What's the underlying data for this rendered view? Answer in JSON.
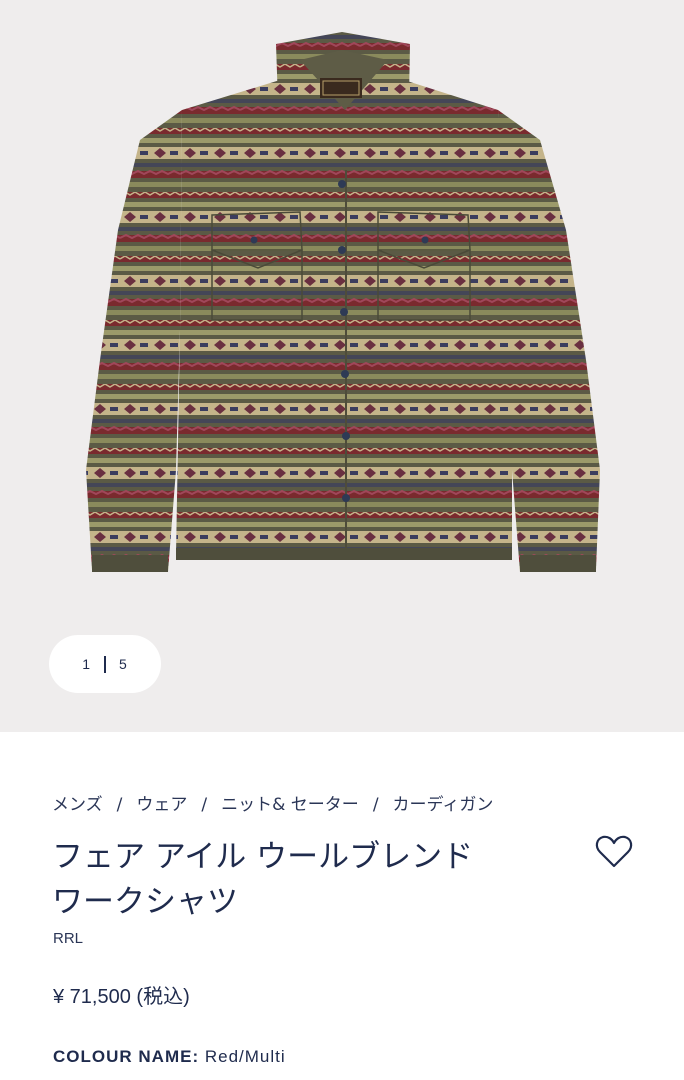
{
  "gallery": {
    "current_page": "1",
    "total_pages": "5",
    "product_image": "fair-isle-work-shirt"
  },
  "breadcrumb": {
    "items": [
      "メンズ",
      "ウェア",
      "ニット& セーター",
      "カーディガン"
    ],
    "separator": "/"
  },
  "product": {
    "title_line1": "フェア アイル ウールブレンド",
    "title_line2": "ワークシャツ",
    "brand": "RRL",
    "price": "¥ 71,500 (税込)",
    "colour_label": "COLOUR NAME:",
    "colour_value": "Red/Multi"
  },
  "icons": {
    "wishlist": "heart-icon"
  },
  "colors": {
    "text": "#1f2b4d",
    "gallery_bg": "#efeded",
    "shirt_olive": "#5b5a45",
    "shirt_red": "#7a2a2e",
    "shirt_tan": "#c4b48a"
  }
}
